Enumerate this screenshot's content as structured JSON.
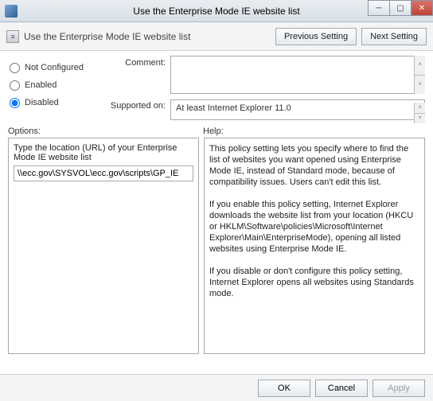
{
  "window": {
    "title": "Use the Enterprise Mode IE website list"
  },
  "header": {
    "title": "Use the Enterprise Mode IE website list",
    "prev_label": "Previous Setting",
    "next_label": "Next Setting"
  },
  "radios": {
    "not_configured": "Not Configured",
    "enabled": "Enabled",
    "disabled": "Disabled",
    "selected": "disabled"
  },
  "labels": {
    "comment": "Comment:",
    "supported_on": "Supported on:",
    "options": "Options:",
    "help": "Help:"
  },
  "fields": {
    "comment_value": "",
    "supported_on_value": "At least Internet Explorer 11.0"
  },
  "options": {
    "location_label": "Type the location (URL) of your Enterprise Mode IE website list",
    "location_value": "\\\\ecc.gov\\SYSVOL\\ecc.gov\\scripts\\GP_IE"
  },
  "help": {
    "p1": "This policy setting lets you specify where to find the list of websites you want opened using Enterprise Mode IE, instead of Standard mode, because of compatibility issues. Users can't edit this list.",
    "p2": "If you enable this policy setting, Internet Explorer downloads the website list from your location (HKCU or HKLM\\Software\\policies\\Microsoft\\Internet Explorer\\Main\\EnterpriseMode), opening all listed websites using Enterprise Mode IE.",
    "p3": "If you disable or don't configure this policy setting, Internet Explorer opens all websites using Standards mode."
  },
  "footer": {
    "ok": "OK",
    "cancel": "Cancel",
    "apply": "Apply"
  }
}
